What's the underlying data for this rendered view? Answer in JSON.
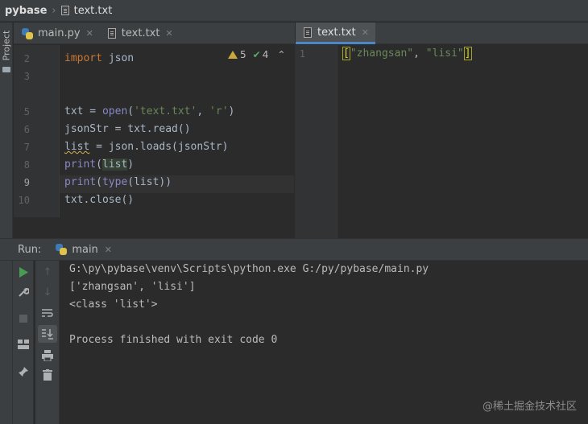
{
  "navbar": {
    "project": "pybase",
    "file": "text.txt"
  },
  "toolwindow": {
    "project_label": "Project"
  },
  "left_tabs": [
    {
      "label": "main.py",
      "icon": "python-file-icon"
    },
    {
      "label": "text.txt",
      "icon": "text-file-icon"
    }
  ],
  "right_tabs": [
    {
      "label": "text.txt",
      "icon": "text-file-icon"
    }
  ],
  "inspections": {
    "warnings": "5",
    "ok": "4"
  },
  "left_editor": {
    "line_numbers": [
      "2",
      "3",
      "5",
      "6",
      "7",
      "8",
      "9",
      "10"
    ],
    "code": {
      "l2_kw": "import",
      "l2_rest": " json",
      "l5_a": "txt = ",
      "l5_fn": "open",
      "l5_b": "(",
      "l5_s1": "'text.txt'",
      "l5_c": ", ",
      "l5_s2": "'r'",
      "l5_d": ")",
      "l6": "jsonStr = txt.read()",
      "l7_var": "list",
      "l7_rest": " = json.loads(jsonStr)",
      "l8_fn": "print",
      "l8_a": "(",
      "l8_var": "list",
      "l8_b": ")",
      "l9_fn": "print",
      "l9_a": "(",
      "l9_fn2": "type",
      "l9_b": "(list))",
      "l10": "txt.close()"
    }
  },
  "right_editor": {
    "line_number": "1",
    "open_bracket": "[",
    "s1": "\"zhangsan\"",
    "comma": ", ",
    "s2": "\"lisi\"",
    "close_bracket": "]"
  },
  "run": {
    "label": "Run:",
    "tab": "main",
    "console": [
      "G:\\py\\pybase\\venv\\Scripts\\python.exe G:/py/pybase/main.py",
      "['zhangsan', 'lisi']",
      "<class 'list'>",
      "",
      "Process finished with exit code 0"
    ]
  },
  "watermark": "@稀土掘金技术社区",
  "colors": {
    "accent": "#4a88c7",
    "keyword": "#cc7832",
    "string": "#6a8759",
    "builtin": "#8888c6",
    "run_green": "#499c54"
  }
}
